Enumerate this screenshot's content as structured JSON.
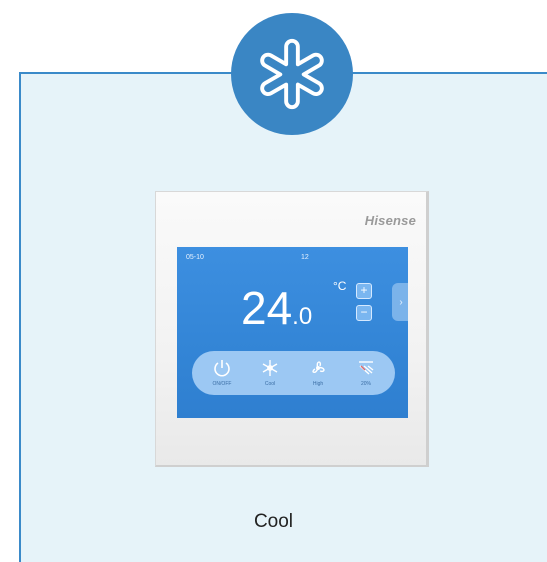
{
  "mode": {
    "icon": "snowflake-icon",
    "caption": "Cool"
  },
  "thermostat": {
    "brand": "Hisense",
    "date": "05-10",
    "time_hint": "12",
    "temperature_int": "24",
    "temperature_dec": ".0",
    "unit": "°C",
    "plus_label": "+",
    "minus_label": "−",
    "side_label": "›",
    "controls": [
      {
        "icon": "power-icon",
        "label": "ON/OFF"
      },
      {
        "icon": "snowflake-mode-icon",
        "label": "Cool"
      },
      {
        "icon": "fan-icon",
        "label": "High"
      },
      {
        "icon": "swing-icon",
        "label": "20%"
      }
    ]
  },
  "colors": {
    "accent": "#3a86c4",
    "card_bg": "#e6f3f9",
    "screen_blue": "#3385d6"
  }
}
